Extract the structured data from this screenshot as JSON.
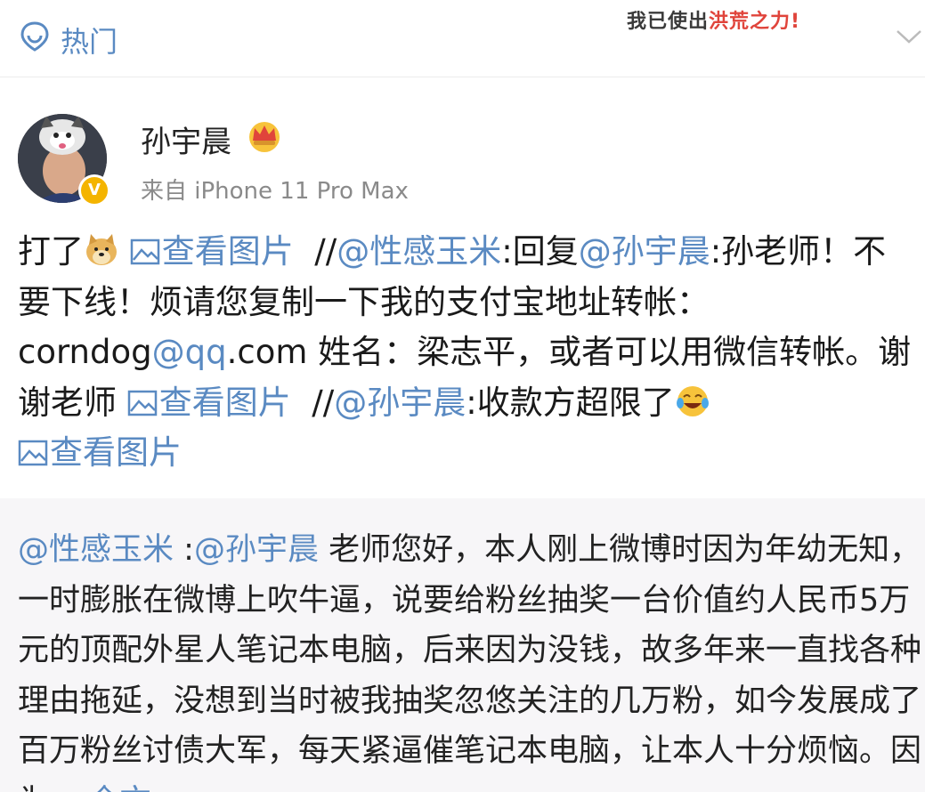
{
  "header": {
    "tab_label": "热门",
    "banner": {
      "part1": "我已使出",
      "part2": "洪荒",
      "part3": "之力!"
    }
  },
  "post": {
    "author": "孙宇晨",
    "source": "来自 iPhone 11 Pro Max",
    "verified_badge": "V",
    "content": {
      "seg1": "打了",
      "pic_label": "查看图片",
      "sep1": "  //",
      "mention1": "@性感玉米",
      "seg2": ":回复",
      "mention2": "@孙宇晨",
      "seg3": ":孙老师！不要下线！烦请您复制一下我的支付宝地址转帐：",
      "email_user": "corndog",
      "email_domain": "@qq",
      "email_tld": ".com",
      "seg4": " 姓名：梁志平，或者可以用微信转帐。谢谢老师 ",
      "sep2": "  //",
      "mention3": "@孙宇晨",
      "seg5": ":收款方超限了"
    }
  },
  "quoted": {
    "mention1": "@性感玉米",
    "sep": " :",
    "mention2": "@孙宇晨",
    "text": " 老师您好，本人刚上微博时因为年幼无知，一时膨胀在微博上吹牛逼，说要给粉丝抽奖一台价值约人民币5万元的顶配外星人笔记本电脑，后来因为没钱，故多年来一直找各种理由拖延，没想到当时被我抽奖忽悠关注的几万粉，如今发展成了百万粉丝讨债大军，每天紧逼催笔记本电脑，让本人十分烦恼。因为...",
    "more": " 全文"
  },
  "icons": {
    "hot": "location-pin-icon",
    "chevron": "chevron-down-icon",
    "crown": "crown-icon",
    "picture": "picture-icon",
    "doge": "doge-emoji-icon",
    "laugh_cry": "laugh-cry-emoji-icon"
  },
  "colors": {
    "link": "#5a8ac2",
    "quote_bg": "#f7f6f8",
    "badge": "#f4b400"
  }
}
